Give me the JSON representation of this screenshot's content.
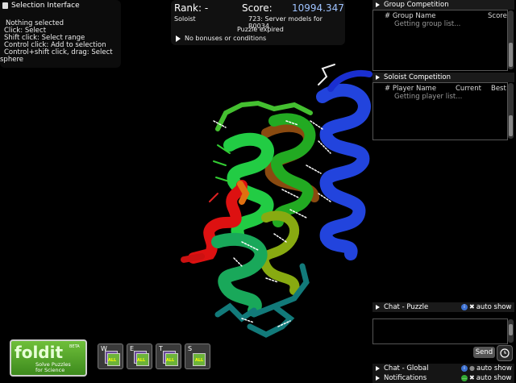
{
  "selection": {
    "title": "Selection Interface",
    "lines": [
      "Nothing selected",
      "Click: Select",
      "Shift click: Select range",
      "Control click: Add to selection",
      "Control+shift click, drag: Select",
      "sphere"
    ]
  },
  "score": {
    "rank_label": "Rank: -",
    "score_label": "Score:",
    "score_value": "10994.347",
    "mode": "Soloist",
    "puzzle": "723: Server models for R0034",
    "status": "Puzzle expired",
    "bonuses": "No bonuses or conditions"
  },
  "group": {
    "title": "Group Competition",
    "col_name": "# Group Name",
    "col_score": "Score",
    "loading": "Getting group list..."
  },
  "soloist": {
    "title": "Soloist Competition",
    "col_name": "# Player Name",
    "col_current": "Current",
    "col_best": "Best",
    "loading": "Getting player list..."
  },
  "chat_puzzle": {
    "title": "Chat - Puzzle",
    "auto": "auto show",
    "send": "Send"
  },
  "chat_global": {
    "title": "Chat - Global",
    "auto": "auto show"
  },
  "notifications": {
    "title": "Notifications",
    "auto": "auto show"
  },
  "logo": {
    "name": "foldit",
    "beta": "BETA",
    "tagline1": "Solve Puzzles",
    "tagline2": "for Science"
  },
  "tools": [
    {
      "key": "W",
      "label": "ALL"
    },
    {
      "key": "E",
      "label": "ALL"
    },
    {
      "key": "T",
      "label": "ALL"
    },
    {
      "key": "S",
      "label": "ALL"
    }
  ]
}
